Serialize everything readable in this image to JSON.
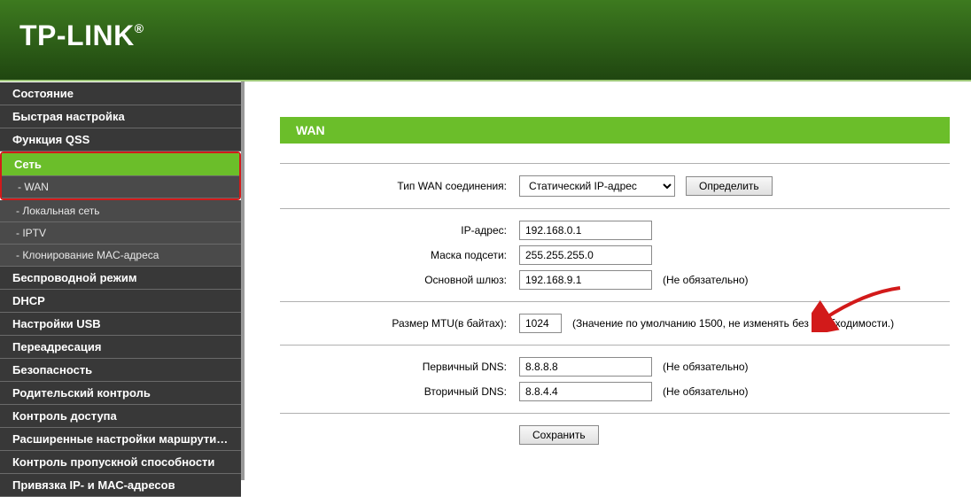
{
  "brand": "TP-LINK",
  "sidebar": {
    "items": [
      {
        "label": "Состояние",
        "type": "item",
        "active": false
      },
      {
        "label": "Быстрая настройка",
        "type": "item",
        "active": false
      },
      {
        "label": "Функция QSS",
        "type": "item",
        "active": false
      },
      {
        "label": "Сеть",
        "type": "item",
        "active": true,
        "hl": true
      },
      {
        "label": "- WAN",
        "type": "sub",
        "active": false,
        "hl": true
      },
      {
        "label": "- Локальная сеть",
        "type": "sub",
        "active": false
      },
      {
        "label": "- IPTV",
        "type": "sub",
        "active": false
      },
      {
        "label": "- Клонирование MAC-адреса",
        "type": "sub",
        "active": false
      },
      {
        "label": "Беспроводной режим",
        "type": "item",
        "active": false
      },
      {
        "label": "DHCP",
        "type": "item",
        "active": false
      },
      {
        "label": "Настройки USB",
        "type": "item",
        "active": false
      },
      {
        "label": "Переадресация",
        "type": "item",
        "active": false
      },
      {
        "label": "Безопасность",
        "type": "item",
        "active": false
      },
      {
        "label": "Родительский контроль",
        "type": "item",
        "active": false
      },
      {
        "label": "Контроль доступа",
        "type": "item",
        "active": false
      },
      {
        "label": "Расширенные настройки маршрутизации",
        "type": "item",
        "active": false
      },
      {
        "label": "Контроль пропускной способности",
        "type": "item",
        "active": false
      },
      {
        "label": "Привязка IP- и МАС-адресов",
        "type": "item",
        "active": false
      }
    ]
  },
  "page": {
    "title": "WAN",
    "wan_type_label": "Тип WAN соединения:",
    "wan_type_value": "Статический IP-адрес",
    "detect_btn": "Определить",
    "ip_label": "IP-адрес:",
    "ip_value": "192.168.0.1",
    "mask_label": "Маска подсети:",
    "mask_value": "255.255.255.0",
    "gw_label": "Основной шлюз:",
    "gw_value": "192.168.9.1",
    "optional": "(Не обязательно)",
    "mtu_label": "Размер MTU(в байтах):",
    "mtu_value": "1024",
    "mtu_hint": "(Значение по умолчанию 1500, не изменять без необходимости.)",
    "dns1_label": "Первичный DNS:",
    "dns1_value": "8.8.8.8",
    "dns2_label": "Вторичный DNS:",
    "dns2_value": "8.8.4.4",
    "save_btn": "Сохранить"
  }
}
